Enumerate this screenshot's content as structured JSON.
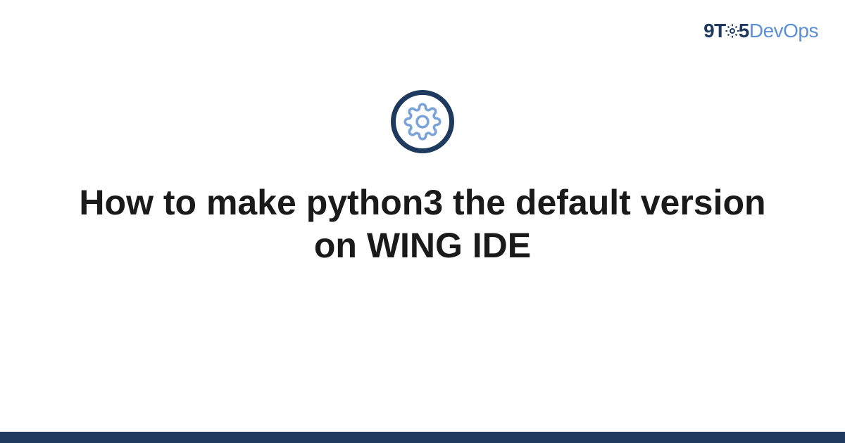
{
  "logo": {
    "part1": "9T",
    "part2": "5",
    "part3": "DevOps"
  },
  "title": "How to make python3 the default version on WING IDE",
  "colors": {
    "brand_dark": "#1e3a5f",
    "brand_light": "#5b8fd6"
  }
}
